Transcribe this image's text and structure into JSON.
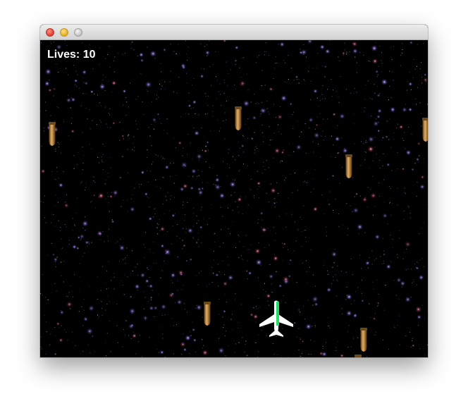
{
  "window": {
    "traffic_lights": [
      "close",
      "minimize",
      "zoom"
    ]
  },
  "hud": {
    "lives_label": "Lives: 10"
  },
  "colors": {
    "background": "#000000",
    "hud_text": "#ffffff",
    "player_body": "#ffffff",
    "player_stripe": "#22dd66",
    "bullet_brass": "#b8863a",
    "bullet_tip": "#d9a057"
  },
  "entities": {
    "player": {
      "icon": "airplane-icon"
    },
    "bullets": [
      {
        "icon": "bullet-icon"
      },
      {
        "icon": "bullet-icon"
      },
      {
        "icon": "bullet-icon"
      },
      {
        "icon": "bullet-icon"
      },
      {
        "icon": "bullet-icon"
      },
      {
        "icon": "bullet-icon"
      },
      {
        "icon": "bullet-icon"
      }
    ]
  }
}
